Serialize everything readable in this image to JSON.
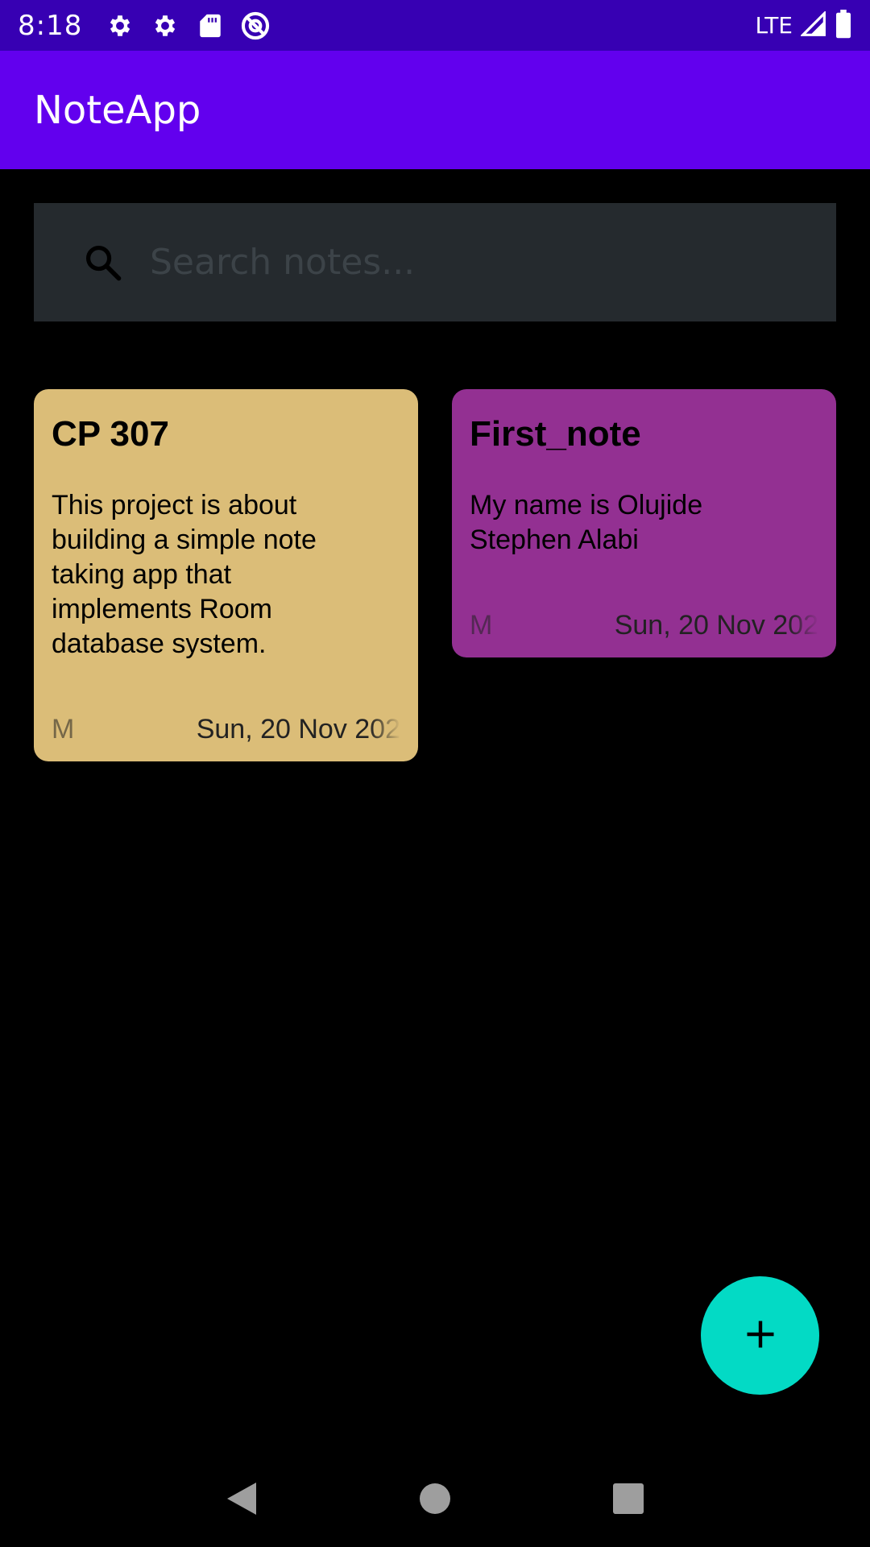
{
  "status_bar": {
    "time": "8:18",
    "network": "LTE",
    "icons": [
      "gear-icon",
      "gear-icon",
      "sd-card-icon",
      "at-sign-icon",
      "signal-icon",
      "battery-icon"
    ]
  },
  "app_bar": {
    "title": "NoteApp"
  },
  "search": {
    "placeholder": "Search notes..."
  },
  "notes": [
    {
      "title": "CP 307",
      "body": "This project is about building a simple note taking app that implements Room database system.",
      "time_partial": "M",
      "date": "Sun, 20 Nov 202",
      "color": "#dbbd78"
    },
    {
      "title": "First_note",
      "body": "My name is Olujide Stephen Alabi",
      "time_partial": "M",
      "date": "Sun, 20 Nov 202",
      "color": "#933092"
    }
  ],
  "fab": {
    "icon": "plus-icon",
    "color": "#03dac5"
  },
  "colors": {
    "status_bar": "#3700b3",
    "app_bar": "#6200ee",
    "search_bg": "#252a2e",
    "background": "#000000"
  },
  "nav_bar": {
    "icons": [
      "back-icon",
      "home-icon",
      "recents-icon"
    ]
  }
}
